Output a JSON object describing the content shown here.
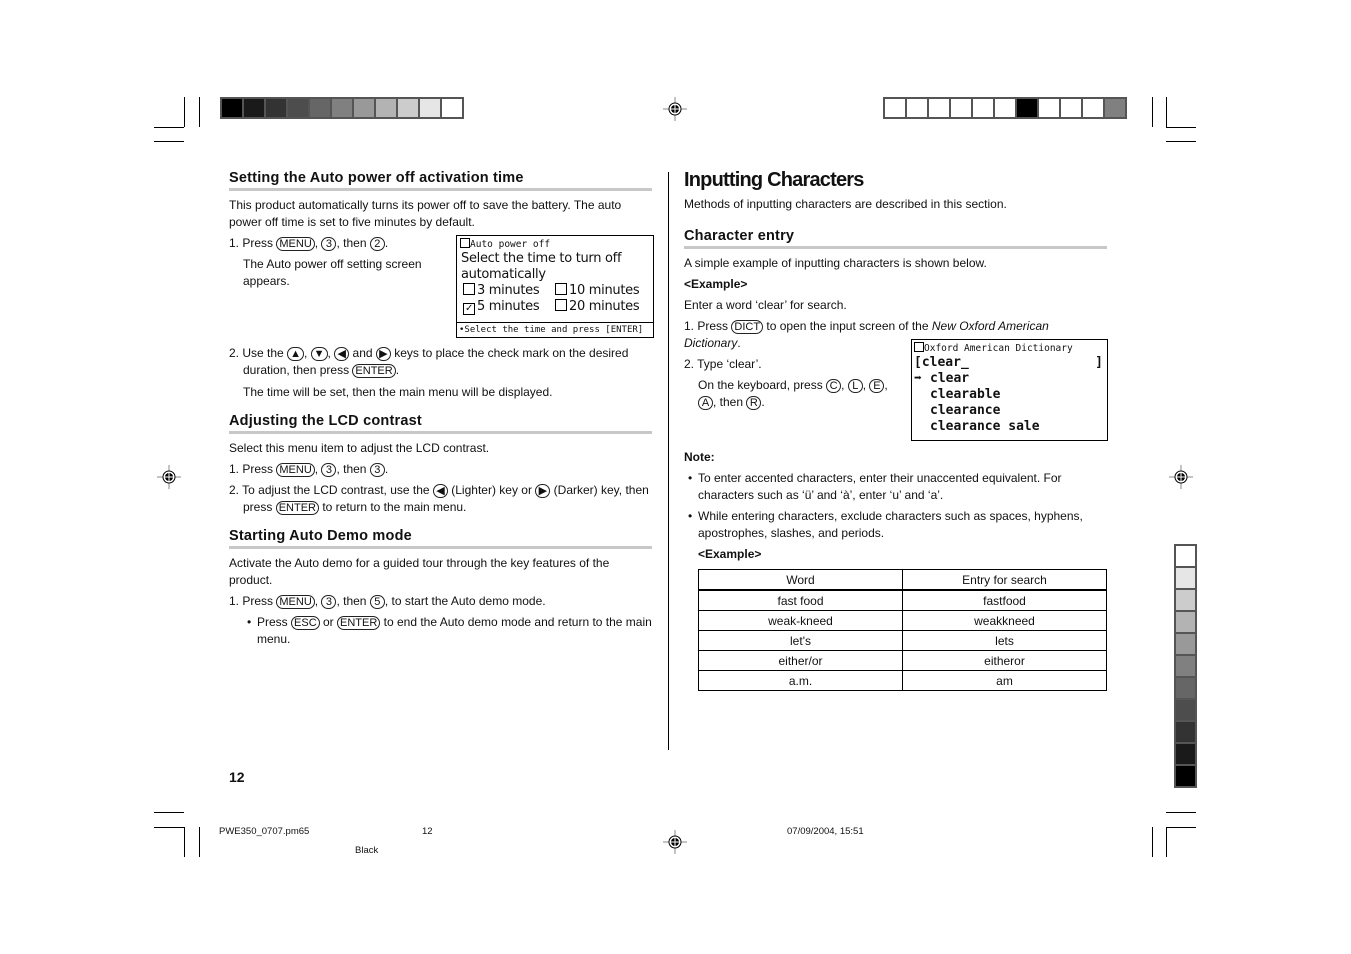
{
  "print_marks": {
    "top_left_swatches": [
      "#000000",
      "#1a1a1a",
      "#333333",
      "#4d4d4d",
      "#666666",
      "#808080",
      "#999999",
      "#b3b3b3",
      "#cccccc",
      "#e6e6e6",
      "#ffffff"
    ],
    "top_right_swatches": [
      "#ffffff",
      "#ffffff",
      "#ffffff",
      "#ffffff",
      "#ffffff",
      "#ffffff",
      "#000000",
      "#ffffff",
      "#ffffff",
      "#ffffff",
      "#808080"
    ],
    "right_swatches": [
      "#ffffff",
      "#e6e6e6",
      "#cccccc",
      "#b3b3b3",
      "#999999",
      "#808080",
      "#666666",
      "#4d4d4d",
      "#333333",
      "#1a1a1a",
      "#000000"
    ]
  },
  "left": {
    "auto_power": {
      "title": "Setting the Auto power off activation time",
      "intro": "This product automatically turns its power off to save the battery. The auto power off time is set to five minutes by default.",
      "step1": {
        "num": "1.",
        "pre": "Press",
        "k1": "MENU",
        "sep1": ",",
        "k2": "3",
        "mid": ", then",
        "k3": "2",
        "end": "."
      },
      "step1_note": "The Auto power off setting screen appears.",
      "step2": {
        "num": "2.",
        "pre": "Use the",
        "k1": "▲",
        "k2": "▼",
        "k3": "◀",
        "and": "and",
        "k4": "▶",
        "post": "keys to place the check mark on the desired duration, then press",
        "k5": "ENTER",
        "end": "."
      },
      "step2_note": "The time will be set, then the main menu will be displayed.",
      "lcd": {
        "header": "Auto power off",
        "line1": "Select the time to turn off",
        "line2": "automatically",
        "options": [
          {
            "label": "3 minutes",
            "checked": false
          },
          {
            "label": "10 minutes",
            "checked": false
          },
          {
            "label": "5 minutes",
            "checked": true
          },
          {
            "label": "20 minutes",
            "checked": false
          }
        ],
        "footer": "•Select the time and press [ENTER]"
      }
    },
    "lcd_contrast": {
      "title": "Adjusting the LCD contrast",
      "intro": "Select this menu item to adjust the LCD contrast.",
      "step1": {
        "num": "1.",
        "pre": "Press",
        "k1": "MENU",
        "k2": "3",
        "mid": ", then",
        "k3": "3",
        "end": "."
      },
      "step2": {
        "num": "2.",
        "pre": "To adjust the LCD contrast, use the",
        "k1": "◀",
        "lighter": "(Lighter) key or",
        "k2": "▶",
        "darker": "(Darker) key, then press",
        "k3": "ENTER",
        "post": "to return to the main menu."
      }
    },
    "auto_demo": {
      "title": "Starting Auto Demo mode",
      "intro": "Activate the Auto demo for a guided tour through the key features of the product.",
      "step1": {
        "num": "1.",
        "pre": "Press",
        "k1": "MENU",
        "k2": "3",
        "mid": ", then",
        "k3": "5",
        "post": ", to start the Auto demo mode."
      },
      "bullet": {
        "pre": "Press",
        "k1": "ESC",
        "or": "or",
        "k2": "ENTER",
        "post": "to end the Auto demo mode and return to the main menu."
      }
    },
    "page_number": "12"
  },
  "right": {
    "title": "Inputting Characters",
    "intro": "Methods of inputting characters are described in this section.",
    "char_entry": {
      "title": "Character entry",
      "intro": "A simple example of inputting characters is shown below.",
      "example_label": "<Example>",
      "example_text": "Enter a word ‘clear’ for search.",
      "step1": {
        "num": "1.",
        "pre": "Press",
        "k1": "DICT",
        "post": "to open the input screen of the",
        "italic": "New Oxford American Dictionary",
        "end": "."
      },
      "step2": {
        "num": "2.",
        "text": "Type ‘clear’."
      },
      "step2_note": {
        "pre": "On the keyboard, press",
        "k1": "C",
        "k2": "L",
        "k3": "E",
        "k4": "A",
        "then": ", then",
        "k5": "R",
        "end": "."
      },
      "lcd": {
        "header": "Oxford American Dictionary",
        "input": "clear_",
        "results": [
          "clear",
          "clearable",
          "clearance",
          "clearance sale"
        ]
      }
    },
    "note": {
      "label": "Note:",
      "bullets": [
        "To enter accented characters, enter their unaccented equivalent. For characters such as ‘ü’ and ‘à’, enter ‘u’ and ‘a’.",
        "While entering characters, exclude characters such as spaces, hyphens, apostrophes, slashes, and periods."
      ],
      "example_label": "<Example>",
      "table": {
        "headers": [
          "Word",
          "Entry for search"
        ],
        "rows": [
          [
            "fast food",
            "fastfood"
          ],
          [
            "weak-kneed",
            "weakkneed"
          ],
          [
            "let's",
            "lets"
          ],
          [
            "either/or",
            "eitheror"
          ],
          [
            "a.m.",
            "am"
          ]
        ]
      }
    }
  },
  "footer": {
    "file": "PWE350_0707.pm65",
    "page": "12",
    "datetime": "07/09/2004, 15:51",
    "color": "Black"
  }
}
